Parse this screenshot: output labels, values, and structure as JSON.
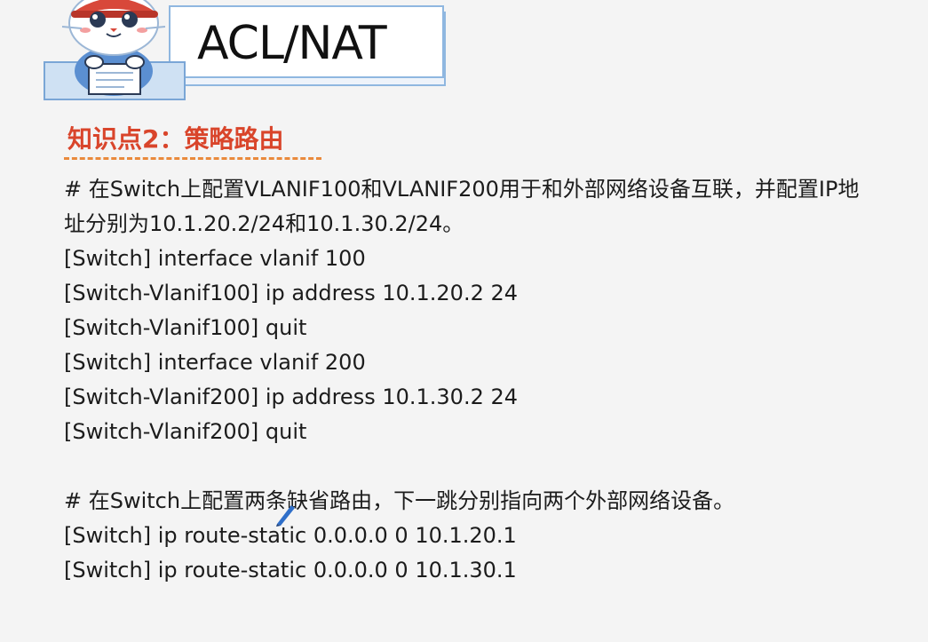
{
  "header": {
    "title": "ACL/NAT"
  },
  "section": {
    "heading": "知识点2：策略路由"
  },
  "content": {
    "lines": [
      "# 在Switch上配置VLANIF100和VLANIF200用于和外部网络设备互联，并配置IP地",
      "址分别为10.1.20.2/24和10.1.30.2/24。",
      "[Switch] interface vlanif 100",
      "[Switch-Vlanif100] ip address 10.1.20.2 24",
      "[Switch-Vlanif100] quit",
      "[Switch] interface vlanif 200",
      "[Switch-Vlanif200] ip address 10.1.30.2 24",
      "[Switch-Vlanif200] quit",
      "# 在Switch上配置两条缺省路由，下一跳分别指向两个外部网络设备。",
      "[Switch] ip route-static 0.0.0.0 0 10.1.20.1",
      "[Switch] ip route-static 0.0.0.0 0 10.1.30.1"
    ]
  },
  "colors": {
    "heading": "#d9452b",
    "underline": "#e98a3c",
    "card_border": "#8fb7e0",
    "mascot_cap": "#d8483a"
  },
  "icons": {
    "mascot": "cat-mascot-icon",
    "pen": "pen-cursor-icon"
  }
}
